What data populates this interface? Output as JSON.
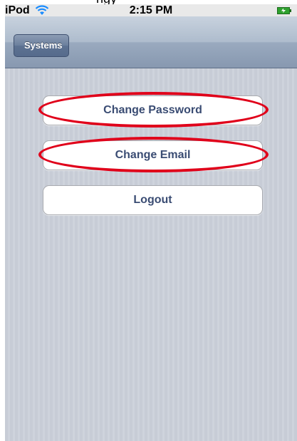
{
  "caption": {
    "text": "ngy"
  },
  "status_bar": {
    "device": "iPod",
    "time": "2:15 PM",
    "wifi_icon": "wifi-icon",
    "battery_icon": "battery-charging-icon"
  },
  "nav_bar": {
    "back_label": "Systems",
    "colors": {
      "bar": "#8798b0",
      "back_button": "#5d7292"
    }
  },
  "buttons": [
    {
      "label": "Change Password",
      "highlighted": true
    },
    {
      "label": "Change Email",
      "highlighted": true
    },
    {
      "label": "Logout",
      "highlighted": false
    }
  ],
  "colors": {
    "button_text": "#3a4c73",
    "highlight": "#e0001a",
    "background_stripes": "#c7ccd6"
  }
}
